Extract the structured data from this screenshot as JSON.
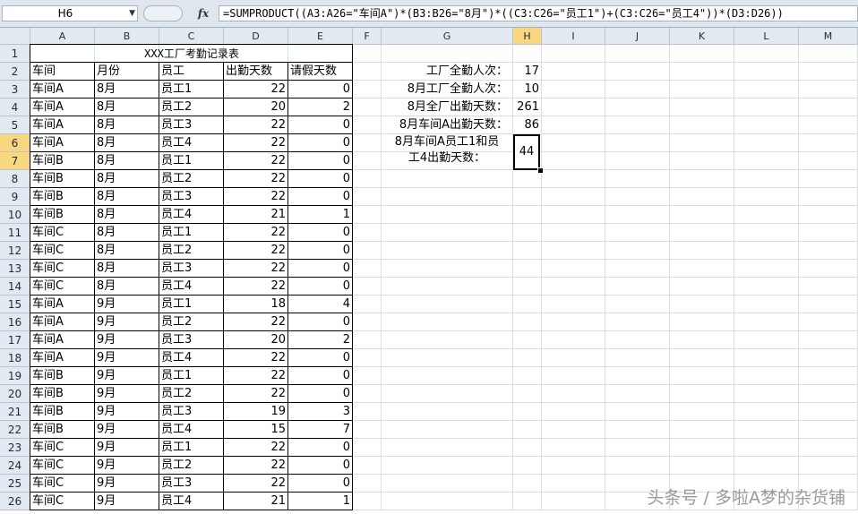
{
  "formula_bar": {
    "name_box": "H6",
    "fx_label": "fx",
    "formula": "=SUMPRODUCT((A3:A26=\"车间A\")*(B3:B26=\"8月\")*((C3:C26=\"员工1\")+(C3:C26=\"员工4\"))*(D3:D26))"
  },
  "columns": [
    "A",
    "B",
    "C",
    "D",
    "E",
    "F",
    "G",
    "H",
    "I",
    "J",
    "K",
    "L",
    "M"
  ],
  "selected_column": "H",
  "rows": [
    "1",
    "2",
    "3",
    "4",
    "5",
    "6",
    "7",
    "8",
    "9",
    "10",
    "11",
    "12",
    "13",
    "14",
    "15",
    "16",
    "17",
    "18",
    "19",
    "20",
    "21",
    "22",
    "23",
    "24",
    "25",
    "26"
  ],
  "selected_rows": [
    "6",
    "7"
  ],
  "table": {
    "title": "XXX工厂考勤记录表",
    "headers": [
      "车间",
      "月份",
      "员工",
      "出勤天数",
      "请假天数"
    ],
    "records": [
      [
        "车间A",
        "8月",
        "员工1",
        "22",
        "0"
      ],
      [
        "车间A",
        "8月",
        "员工2",
        "20",
        "2"
      ],
      [
        "车间A",
        "8月",
        "员工3",
        "22",
        "0"
      ],
      [
        "车间A",
        "8月",
        "员工4",
        "22",
        "0"
      ],
      [
        "车间B",
        "8月",
        "员工1",
        "22",
        "0"
      ],
      [
        "车间B",
        "8月",
        "员工2",
        "22",
        "0"
      ],
      [
        "车间B",
        "8月",
        "员工3",
        "22",
        "0"
      ],
      [
        "车间B",
        "8月",
        "员工4",
        "21",
        "1"
      ],
      [
        "车间C",
        "8月",
        "员工1",
        "22",
        "0"
      ],
      [
        "车间C",
        "8月",
        "员工2",
        "22",
        "0"
      ],
      [
        "车间C",
        "8月",
        "员工3",
        "22",
        "0"
      ],
      [
        "车间C",
        "8月",
        "员工4",
        "22",
        "0"
      ],
      [
        "车间A",
        "9月",
        "员工1",
        "18",
        "4"
      ],
      [
        "车间A",
        "9月",
        "员工2",
        "22",
        "0"
      ],
      [
        "车间A",
        "9月",
        "员工3",
        "20",
        "2"
      ],
      [
        "车间A",
        "9月",
        "员工4",
        "22",
        "0"
      ],
      [
        "车间B",
        "9月",
        "员工1",
        "22",
        "0"
      ],
      [
        "车间B",
        "9月",
        "员工2",
        "22",
        "0"
      ],
      [
        "车间B",
        "9月",
        "员工3",
        "19",
        "3"
      ],
      [
        "车间B",
        "9月",
        "员工4",
        "15",
        "7"
      ],
      [
        "车间C",
        "9月",
        "员工1",
        "22",
        "0"
      ],
      [
        "车间C",
        "9月",
        "员工2",
        "22",
        "0"
      ],
      [
        "车间C",
        "9月",
        "员工3",
        "22",
        "0"
      ],
      [
        "车间C",
        "9月",
        "员工4",
        "21",
        "1"
      ]
    ]
  },
  "summary": [
    {
      "label": "工厂全勤人次：",
      "value": "17"
    },
    {
      "label": "8月工厂全勤人次：",
      "value": "10"
    },
    {
      "label": "8月全厂出勤天数：",
      "value": "261"
    },
    {
      "label": "8月车间A出勤天数：",
      "value": "86"
    }
  ],
  "active_cell": {
    "label_line1": "8月车间A员工1和员",
    "label_line2": "工4出勤天数：",
    "value": "44"
  },
  "watermark": "头条号 / 多啦A梦的杂货铺"
}
